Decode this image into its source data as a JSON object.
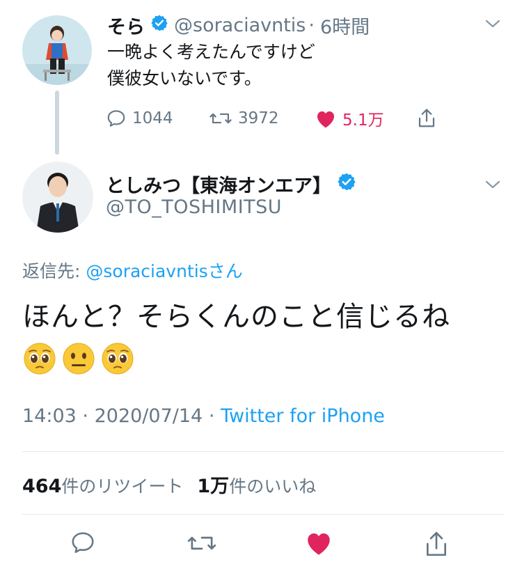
{
  "parent_tweet": {
    "display_name": "そら",
    "handle": "@soraciavntis",
    "separator": "·",
    "time": "6時間",
    "text": "一晩よく考えたんですけど\n僕彼女いないです。",
    "actions": {
      "reply_count": "1044",
      "retweet_count": "3972",
      "like_count": "5.1万"
    }
  },
  "reply_tweet": {
    "display_name": "としみつ【東海オンエア】",
    "handle": "@TO_TOSHIMITSU",
    "replying_to_label": "返信先: ",
    "replying_to_mention": "@soraciavntis",
    "replying_to_suffix": "さん",
    "text": "ほんと？そらくんのこと信じるね",
    "emojis": [
      "pleading-face",
      "neutral-face",
      "pleading-face"
    ],
    "time": "14:03",
    "date": "2020/07/14",
    "dot": "·",
    "source": "Twitter for iPhone",
    "retweets_num": "464",
    "retweets_label": "件のリツイート",
    "likes_num": "1万",
    "likes_label": "件のいいね"
  },
  "colors": {
    "accent": "#1da1f2",
    "like": "#e0245e",
    "muted": "#657786",
    "text": "#14171a",
    "thread_line": "#ccd6dd"
  },
  "icons": {
    "reply": "reply-bubble-icon",
    "retweet": "retweet-icon",
    "like": "heart-icon",
    "share": "share-icon",
    "verified": "verified-badge-icon",
    "caret": "chevron-down-icon"
  }
}
